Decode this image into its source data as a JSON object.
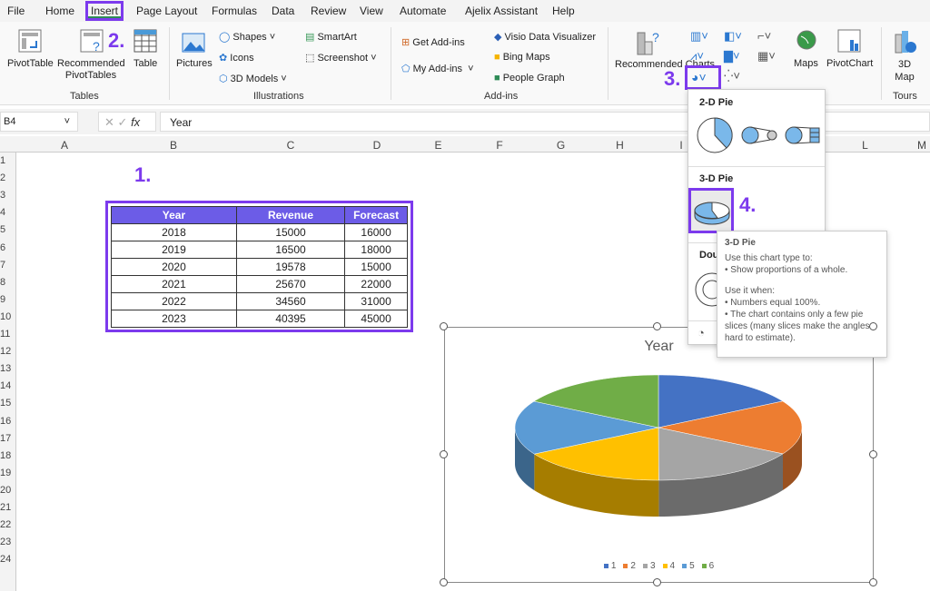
{
  "menu": {
    "tabs": [
      "File",
      "Home",
      "Insert",
      "Page Layout",
      "Formulas",
      "Data",
      "Review",
      "View",
      "Automate",
      "Ajelix Assistant",
      "Help"
    ],
    "active": "Insert"
  },
  "ribbon": {
    "tables": {
      "pivottable": "PivotTable",
      "recommended": "Recommended PivotTables",
      "table": "Table",
      "group": "Tables"
    },
    "illustrations": {
      "pictures": "Pictures",
      "shapes": "Shapes",
      "icons": "Icons",
      "models": "3D Models",
      "smartart": "SmartArt",
      "screenshot": "Screenshot",
      "group": "Illustrations"
    },
    "addins": {
      "get": "Get Add-ins",
      "my": "My Add-ins",
      "visio": "Visio Data Visualizer",
      "bing": "Bing Maps",
      "people": "People Graph",
      "group": "Add-ins"
    },
    "charts": {
      "recommended": "Recommended Charts",
      "maps": "Maps",
      "pivotchart": "PivotChart"
    },
    "tours": {
      "map3d": "3D Map",
      "group": "Tours"
    }
  },
  "steps": {
    "s1": "1.",
    "s2": "2.",
    "s3": "3.",
    "s4": "4."
  },
  "formula_bar": {
    "name_box": "B4",
    "fx": "fx",
    "value": "Year"
  },
  "columns": [
    "A",
    "B",
    "C",
    "D",
    "E",
    "F",
    "G",
    "H",
    "I",
    "J",
    "K",
    "L",
    "M"
  ],
  "rows": [
    "1",
    "2",
    "3",
    "4",
    "5",
    "6",
    "7",
    "8",
    "9",
    "10",
    "11",
    "12",
    "13",
    "14",
    "15",
    "16",
    "17",
    "18",
    "19",
    "20",
    "21",
    "22",
    "23",
    "24"
  ],
  "table": {
    "headers": [
      "Year",
      "Revenue",
      "Forecast"
    ],
    "rows": [
      [
        "2018",
        "15000",
        "16000"
      ],
      [
        "2019",
        "16500",
        "18000"
      ],
      [
        "2020",
        "19578",
        "15000"
      ],
      [
        "2021",
        "25670",
        "22000"
      ],
      [
        "2022",
        "34560",
        "31000"
      ],
      [
        "2023",
        "40395",
        "45000"
      ]
    ]
  },
  "dropdown": {
    "pie2d": "2-D Pie",
    "pie3d": "3-D Pie",
    "doughnut": "Dou"
  },
  "tooltip": {
    "title": "3-D Pie",
    "l1": "Use this chart type to:",
    "l2": "• Show proportions of a whole.",
    "l3": "Use it when:",
    "l4": "• Numbers equal 100%.",
    "l5": "• The chart contains only a few pie slices (many slices make the angles hard to estimate)."
  },
  "chart_data": {
    "type": "pie",
    "title": "Year",
    "categories": [
      "1",
      "2",
      "3",
      "4",
      "5",
      "6"
    ],
    "values": [
      2018,
      2019,
      2020,
      2021,
      2022,
      2023
    ],
    "colors": [
      "#4472c4",
      "#ed7d31",
      "#a5a5a5",
      "#ffc000",
      "#5b9bd5",
      "#70ad47"
    ],
    "legend": "bottom",
    "style": "3-D"
  }
}
